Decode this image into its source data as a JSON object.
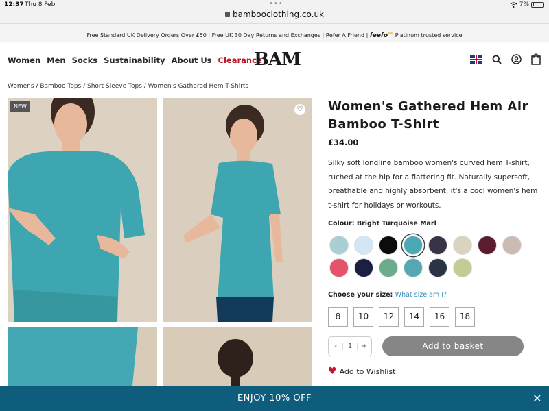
{
  "status_bar": {
    "time": "12:37",
    "date": "Thu 8 Feb",
    "dots": "•••",
    "battery": "7%",
    "url": "bambooclothing.co.uk"
  },
  "promo": {
    "text": "Free Standard UK Delivery Orders Over £50 | Free UK 30 Day Returns and Exchanges | Refer A Friend |",
    "feefo": "feefo",
    "feefo_sup": "ee",
    "trust": "Platinum trusted service"
  },
  "nav": {
    "links": [
      "Women",
      "Men",
      "Socks",
      "Sustainability",
      "About Us"
    ],
    "clearance": "Clearance",
    "logo": "BAM"
  },
  "icons": {
    "flag": "uk-flag-icon",
    "search": "search-icon",
    "account": "account-icon",
    "bag": "shopping-bag-icon"
  },
  "breadcrumb": "Womens / Bamboo Tops / Short Sleeve Tops / Women's Gathered Hem T-Shirts",
  "gallery": {
    "new_badge": "NEW",
    "wish_heart": "♡"
  },
  "product": {
    "title": "Women's Gathered Hem Air Bamboo T-Shirt",
    "price": "£34.00",
    "description": "Silky soft longline bamboo women's curved hem T-shirt, ruched at the hip for a flattering fit. Naturally supersoft, breathable and highly absorbent, it's a cool women's hem t-shirt for holidays or workouts.",
    "colour_label": "Colour: Bright Turquoise Marl",
    "colours": [
      "#a9cfd3",
      "#d3e6f3",
      "#0c0c0c",
      "#4aa9b3",
      "#3a3245",
      "#d9d3c0",
      "#5a1d2e",
      "#cbbbb2",
      "#e45368",
      "#1c1f44",
      "#6bac8d",
      "#57a7b2",
      "#2b3347",
      "#c4cc94"
    ],
    "selected_colour_index": 3,
    "size_label": "Choose your size:",
    "size_guide": "What size am I?",
    "sizes": [
      "8",
      "10",
      "12",
      "14",
      "16",
      "18"
    ],
    "qty_minus": "-",
    "qty_value": "1",
    "qty_plus": "+",
    "add_to_basket": "Add to basket",
    "wishlist": "Add to Wishlist"
  },
  "banner": {
    "text": "ENJOY 10% OFF",
    "close": "✕"
  }
}
